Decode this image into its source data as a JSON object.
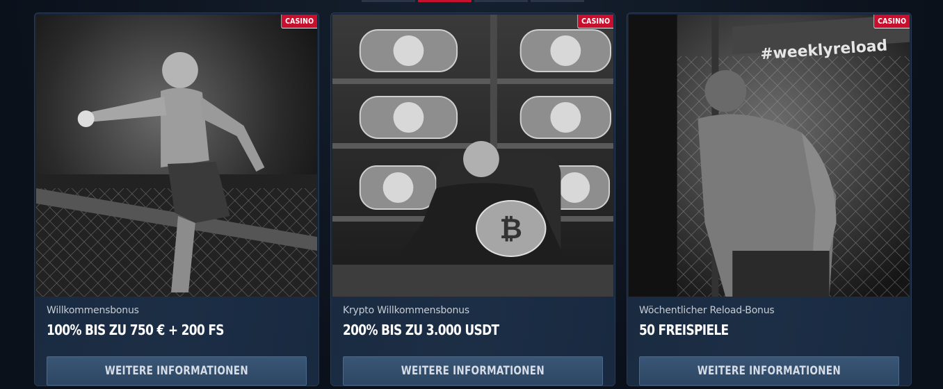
{
  "cards": [
    {
      "badge": "CASINO",
      "subtitle": "Willkommensbonus",
      "title": "100% BIS ZU 750 € + 200 FS",
      "button": "WEITERE INFORMATIONEN",
      "image": "mma-fighter-on-cage-pointing"
    },
    {
      "badge": "CASINO",
      "subtitle": "Krypto Willkommensbonus",
      "title": "200% BIS ZU 3.000 USDT",
      "button": "WEITERE INFORMATIONEN",
      "image": "fighter-in-chair-with-crypto-belts"
    },
    {
      "badge": "CASINO",
      "subtitle": "Wöchentlicher Reload-Bonus",
      "title": "50 FREISPIELE",
      "button": "WEITERE INFORMATIONEN",
      "image": "fighter-in-octagon-weeklyreload",
      "image_caption": "#weeklyreload"
    }
  ]
}
